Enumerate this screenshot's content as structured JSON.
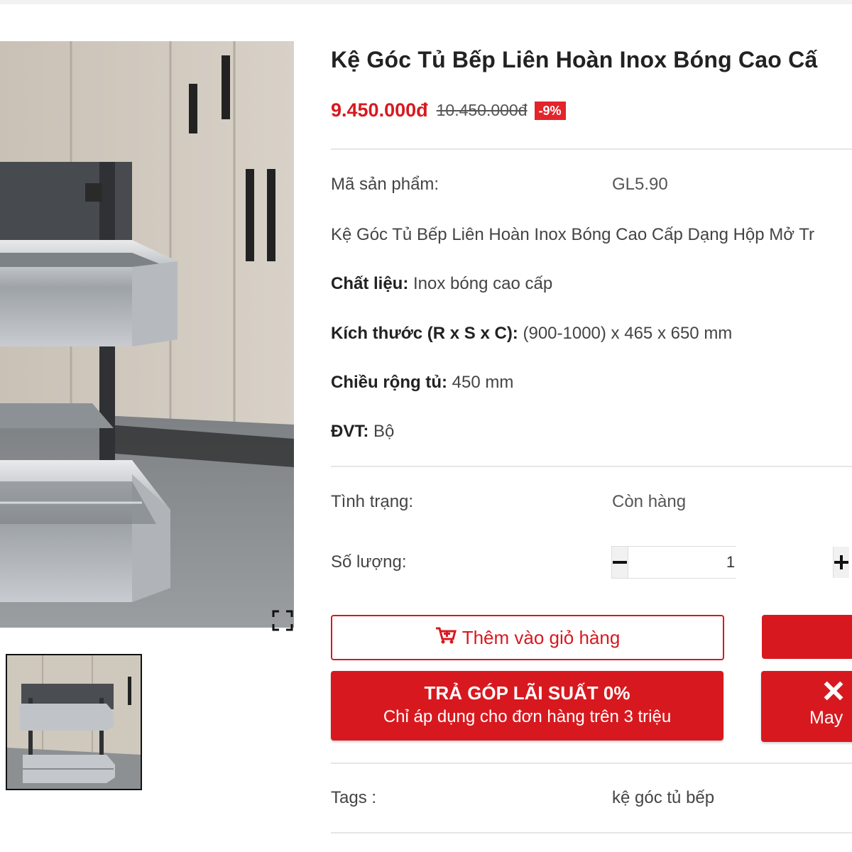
{
  "product": {
    "title": "Kệ Góc Tủ Bếp Liên Hoàn Inox Bóng Cao Cấ",
    "price": "9.450.000đ",
    "old_price": "10.450.000đ",
    "discount": "-9%"
  },
  "details": {
    "sku_label": "Mã sản phẩm:",
    "sku_value": "GL5.90",
    "summary": "Kệ Góc Tủ Bếp Liên Hoàn Inox Bóng Cao Cấp Dạng Hộp Mở Tr",
    "material_label": "Chất liệu:",
    "material_value": " Inox bóng cao cấp",
    "size_label": "Kích thước (R x S x C):",
    "size_value": " (900-1000) x 465 x 650 mm",
    "width_label": "Chiều rộng tủ:",
    "width_value": " 450 mm",
    "unit_label": "ĐVT:",
    "unit_value": " Bộ"
  },
  "stock": {
    "status_label": "Tình trạng:",
    "status_value": "Còn hàng",
    "qty_label": "Số lượng:",
    "qty_value": "1"
  },
  "actions": {
    "add_to_cart": "Thêm vào giỏ hàng",
    "installment_title": "TRẢ GÓP LÃI SUẤT 0%",
    "installment_sub": "Chỉ áp dụng cho đơn hàng trên 3 triệu",
    "second_button_sub": "May"
  },
  "tags": {
    "label": "Tags :",
    "value": "kệ góc tủ bếp"
  },
  "icons": {
    "fullscreen": "fullscreen-icon",
    "cart": "cart-plus-icon",
    "minus": "minus-icon",
    "plus": "plus-icon",
    "tools": "tools-icon"
  },
  "colors": {
    "accent": "#d7191f",
    "discount_badge": "#e3242b"
  }
}
